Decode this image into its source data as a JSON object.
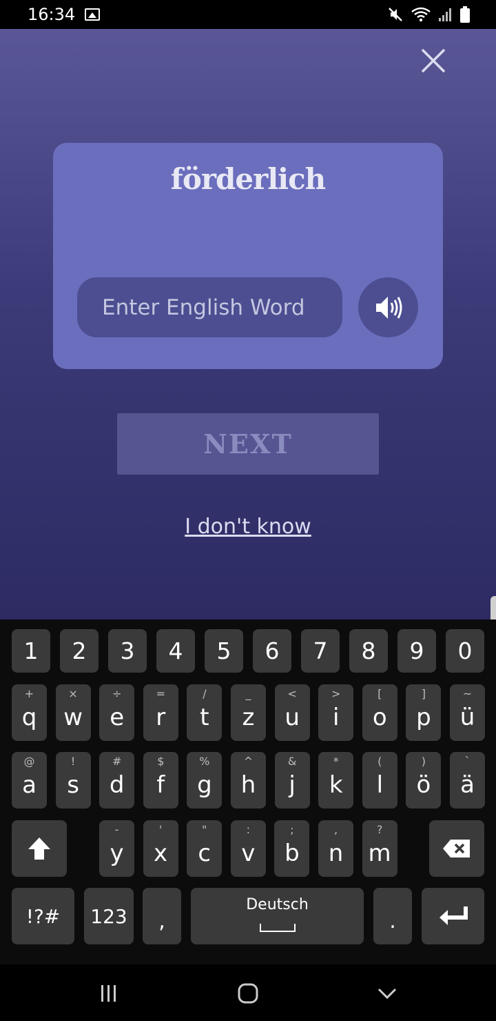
{
  "status_bar": {
    "time": "16:34"
  },
  "app": {
    "word": "förderlich",
    "input_placeholder": "Enter English Word",
    "input_value": "",
    "next_label": "NEXT",
    "dont_know_label": "I don't know",
    "colors": {
      "card": "#6b6ebd",
      "input_bg": "#4c4e91",
      "next_bg": "#565592"
    }
  },
  "keyboard": {
    "language_label": "Deutsch",
    "number_row": [
      "1",
      "2",
      "3",
      "4",
      "5",
      "6",
      "7",
      "8",
      "9",
      "0"
    ],
    "row1": [
      {
        "key": "q",
        "hint": "+"
      },
      {
        "key": "w",
        "hint": "×"
      },
      {
        "key": "e",
        "hint": "÷"
      },
      {
        "key": "r",
        "hint": "="
      },
      {
        "key": "t",
        "hint": "/"
      },
      {
        "key": "z",
        "hint": "_"
      },
      {
        "key": "u",
        "hint": "<"
      },
      {
        "key": "i",
        "hint": ">"
      },
      {
        "key": "o",
        "hint": "["
      },
      {
        "key": "p",
        "hint": "]"
      },
      {
        "key": "ü",
        "hint": "~"
      }
    ],
    "row2": [
      {
        "key": "a",
        "hint": "@"
      },
      {
        "key": "s",
        "hint": "!"
      },
      {
        "key": "d",
        "hint": "#"
      },
      {
        "key": "f",
        "hint": "$"
      },
      {
        "key": "g",
        "hint": "%"
      },
      {
        "key": "h",
        "hint": "^"
      },
      {
        "key": "j",
        "hint": "&"
      },
      {
        "key": "k",
        "hint": "*"
      },
      {
        "key": "l",
        "hint": "("
      },
      {
        "key": "ö",
        "hint": ")"
      },
      {
        "key": "ä",
        "hint": "`"
      }
    ],
    "row3": [
      {
        "key": "y",
        "hint": "-"
      },
      {
        "key": "x",
        "hint": "'"
      },
      {
        "key": "c",
        "hint": "\""
      },
      {
        "key": "v",
        "hint": ":"
      },
      {
        "key": "b",
        "hint": ";"
      },
      {
        "key": "n",
        "hint": ","
      },
      {
        "key": "m",
        "hint": "?"
      }
    ],
    "symbols_label": "!?#",
    "numbers_label": "123",
    "comma_label": ",",
    "period_label": "."
  }
}
